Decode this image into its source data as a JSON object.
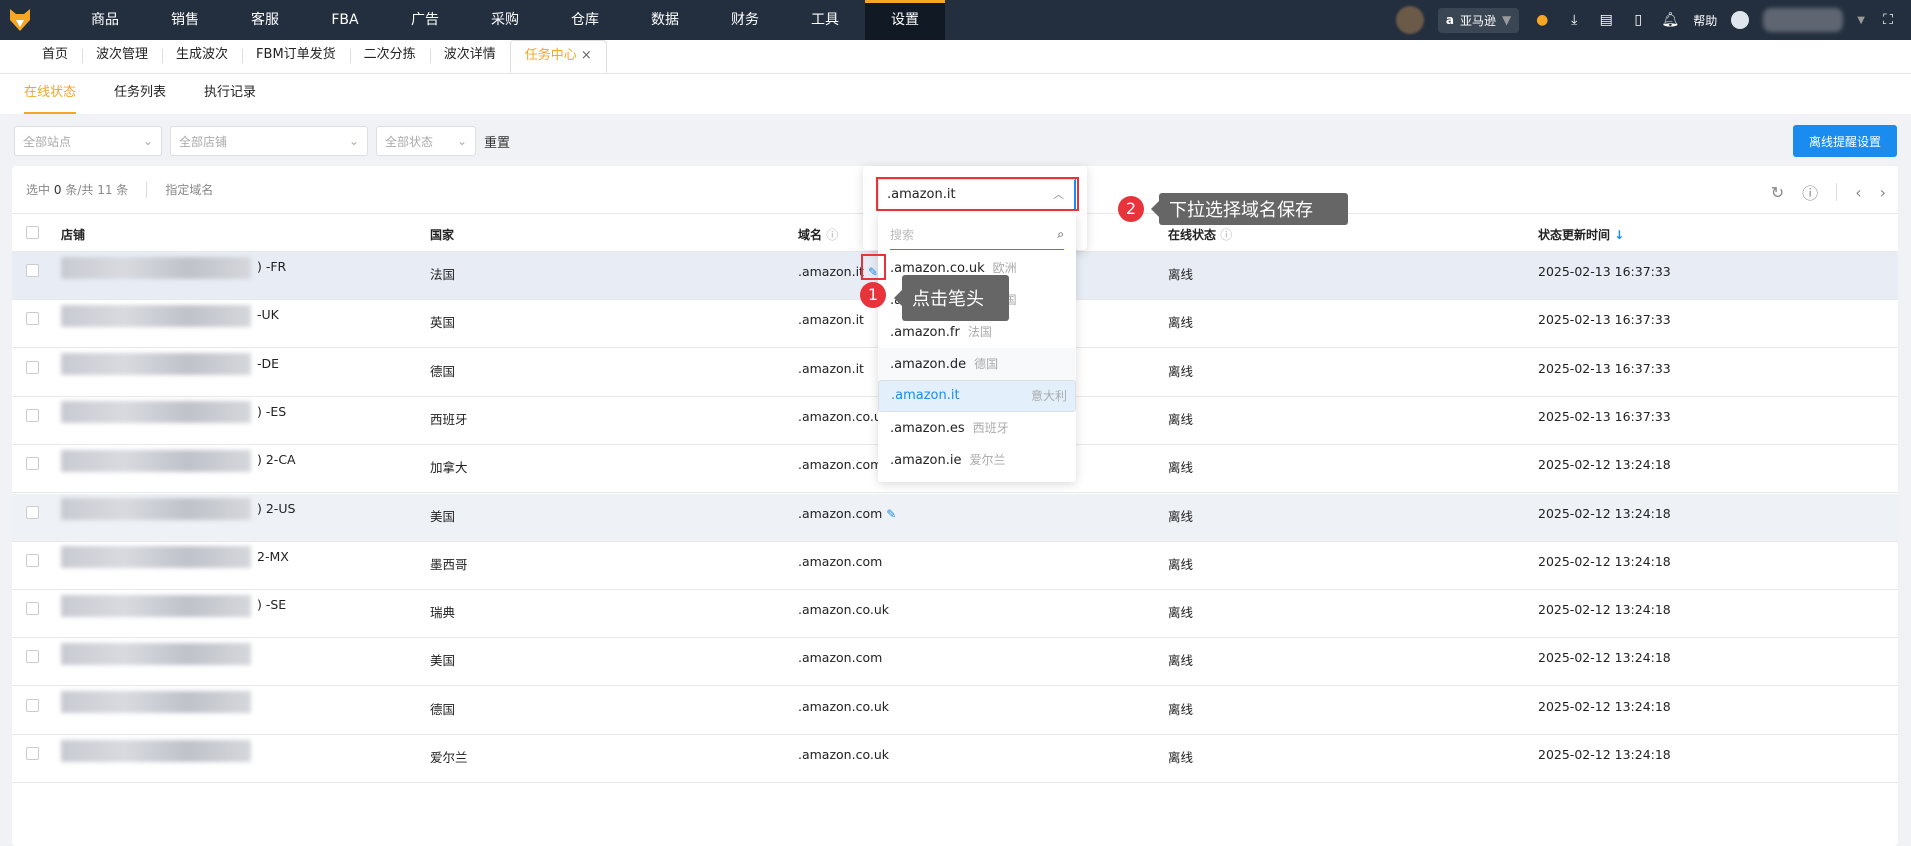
{
  "nav": {
    "items": [
      "商品",
      "销售",
      "客服",
      "FBA",
      "广告",
      "采购",
      "仓库",
      "数据",
      "财务",
      "工具",
      "设置"
    ],
    "active": "设置",
    "site": "亚马逊",
    "help": "帮助"
  },
  "page_tabs": [
    {
      "label": "首页"
    },
    {
      "label": "波次管理"
    },
    {
      "label": "生成波次"
    },
    {
      "label": "FBM订单发货"
    },
    {
      "label": "二次分拣"
    },
    {
      "label": "波次详情"
    },
    {
      "label": "任务中心",
      "active": true
    }
  ],
  "sub_tabs": [
    "在线状态",
    "任务列表",
    "执行记录"
  ],
  "filters": {
    "site": "全部站点",
    "shop": "全部店铺",
    "status": "全部状态",
    "reset": "重置"
  },
  "offline_alert_button": "离线提醒设置",
  "toolbar": {
    "selected_prefix": "选中",
    "selected": "0",
    "selected_mid": "条/共",
    "total": "11",
    "unit": "条",
    "assign_domain": "指定域名"
  },
  "columns": [
    "店铺",
    "国家",
    "域名",
    "在线状态",
    "状态更新时间"
  ],
  "rows": [
    {
      "store": ") -FR",
      "country": "法国",
      "domain": ".amazon.it",
      "status": "离线",
      "time": "2025-02-13 16:37:33"
    },
    {
      "store": "-UK",
      "country": "英国",
      "domain": ".amazon.it",
      "status": "离线",
      "time": "2025-02-13 16:37:33"
    },
    {
      "store": "-DE",
      "country": "德国",
      "domain": ".amazon.it",
      "status": "离线",
      "time": "2025-02-13 16:37:33"
    },
    {
      "store": ") -ES",
      "country": "西班牙",
      "domain": ".amazon.co.uk",
      "status": "离线",
      "time": "2025-02-13 16:37:33"
    },
    {
      "store": ") 2-CA",
      "country": "加拿大",
      "domain": ".amazon.com",
      "status": "离线",
      "time": "2025-02-12 13:24:18"
    },
    {
      "store": ") 2-US",
      "country": "美国",
      "domain": ".amazon.com",
      "status": "离线",
      "time": "2025-02-12 13:24:18"
    },
    {
      "store": "2-MX",
      "country": "墨西哥",
      "domain": ".amazon.com",
      "status": "离线",
      "time": "2025-02-12 13:24:18"
    },
    {
      "store": ") -SE",
      "country": "瑞典",
      "domain": ".amazon.co.uk",
      "status": "离线",
      "time": "2025-02-12 13:24:18"
    },
    {
      "store": "",
      "country": "美国",
      "domain": ".amazon.com",
      "status": "离线",
      "time": "2025-02-12 13:24:18"
    },
    {
      "store": "",
      "country": "德国",
      "domain": ".amazon.co.uk",
      "status": "离线",
      "time": "2025-02-12 13:24:18"
    },
    {
      "store": "",
      "country": "爱尔兰",
      "domain": ".amazon.co.uk",
      "status": "离线",
      "time": "2025-02-12 13:24:18"
    }
  ],
  "domain_select": {
    "value": ".amazon.it",
    "search_placeholder": "搜索",
    "options": [
      {
        "domain": ".amazon.co.uk",
        "region": "欧洲"
      },
      {
        "domain": ".amazon.co.uk",
        "region": "英国"
      },
      {
        "domain": ".amazon.fr",
        "region": "法国"
      },
      {
        "domain": ".amazon.de",
        "region": "德国"
      },
      {
        "domain": ".amazon.it",
        "region": "意大利"
      },
      {
        "domain": ".amazon.es",
        "region": "西班牙"
      },
      {
        "domain": ".amazon.ie",
        "region": "爱尔兰"
      }
    ]
  },
  "annotations": [
    {
      "num": "1",
      "text": "点击笔头"
    },
    {
      "num": "2",
      "text": "下拉选择域名保存"
    }
  ],
  "colors": {
    "accent": "#f5a623",
    "primary": "#1a8cf0",
    "nav_bg": "#232f3e",
    "annotation": "#e8333a"
  }
}
